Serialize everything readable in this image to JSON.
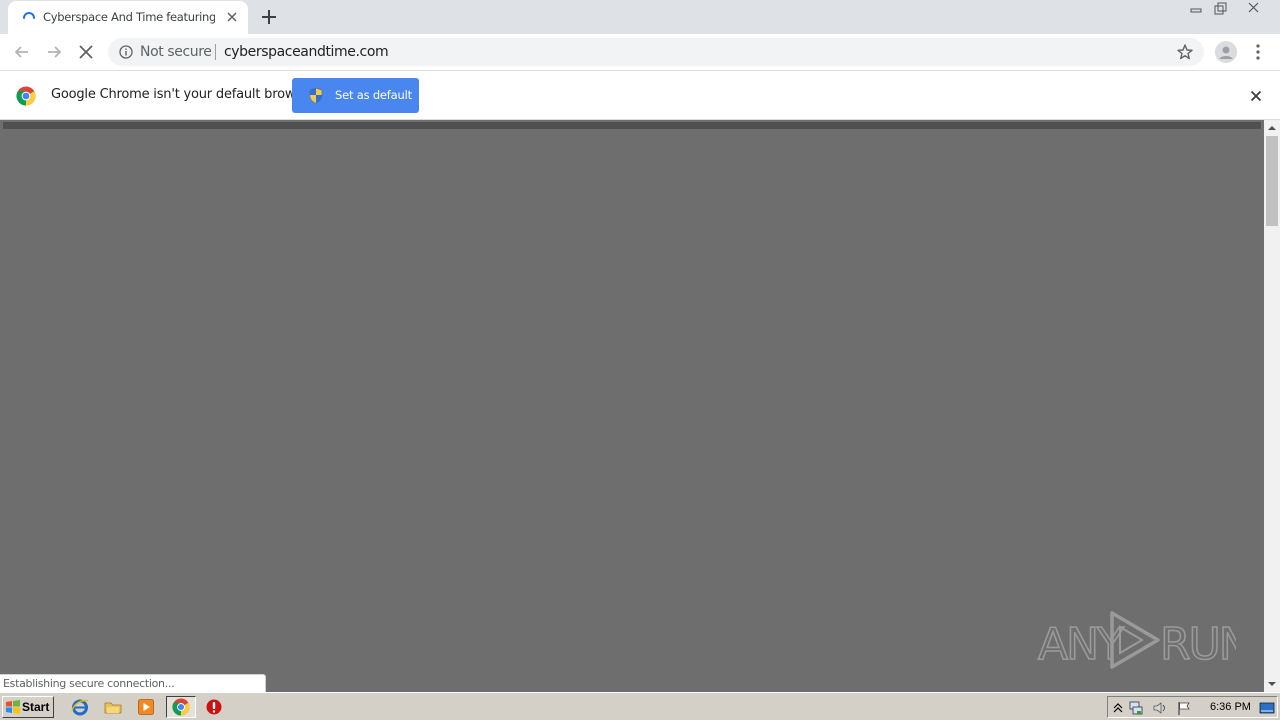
{
  "tab": {
    "title": "Cyberspace And Time featuring the",
    "loading": true
  },
  "toolbar": {
    "security_label": "Not secure",
    "url": "cyberspaceandtime.com"
  },
  "infobar": {
    "message": "Google Chrome isn't your default browser",
    "button_label": "Set as default"
  },
  "status": {
    "text": "Establishing secure connection..."
  },
  "taskbar": {
    "start_label": "Start",
    "clock": "6:36 PM"
  },
  "colors": {
    "accent": "#4a86f0",
    "page_background": "#6e6e6e"
  }
}
